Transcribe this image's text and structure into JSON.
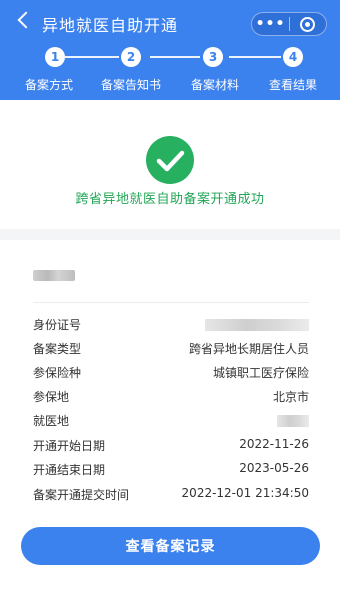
{
  "header": {
    "title": "异地就医自助开通",
    "bg_color": "#3c82ee",
    "more_icon": "more-dots-icon",
    "close_icon": "target-close-icon"
  },
  "steps": [
    {
      "number": "1",
      "label": "备案方式"
    },
    {
      "number": "2",
      "label": "备案告知书"
    },
    {
      "number": "3",
      "label": "备案材料"
    },
    {
      "number": "4",
      "label": "查看结果"
    }
  ],
  "result": {
    "icon": "check-icon",
    "icon_color": "#27b060",
    "message": "跨省异地就医自助备案开通成功"
  },
  "details": [
    {
      "key": "身份证号",
      "value": null,
      "masked": true
    },
    {
      "key": "备案类型",
      "value": "跨省异地长期居住人员",
      "masked": false
    },
    {
      "key": "参保险种",
      "value": "城镇职工医疗保险",
      "masked": false
    },
    {
      "key": "参保地",
      "value": "北京市",
      "masked": false
    },
    {
      "key": "就医地",
      "value": null,
      "masked": true
    },
    {
      "key": "开通开始日期",
      "value": "2022-11-26",
      "masked": false
    },
    {
      "key": "开通结束日期",
      "value": "2023-05-26",
      "masked": false
    },
    {
      "key": "备案开通提交时间",
      "value": "2022-12-01 21:34:50",
      "masked": false
    }
  ],
  "button": {
    "label": "查看备案记录"
  }
}
